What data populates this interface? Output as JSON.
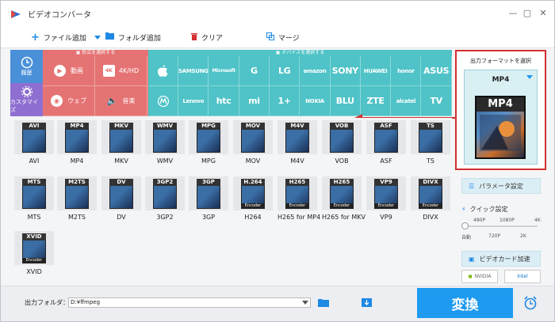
{
  "window": {
    "title": "ビデオコンバータ",
    "controls": [
      "minimize-icon",
      "maximize-icon",
      "close-icon"
    ]
  },
  "toolbar": {
    "add_file": "ファイル追加",
    "add_folder": "フォルダ追加",
    "clear": "クリア",
    "merge": "マージ"
  },
  "left_tabs": {
    "history": "履歴",
    "custom": "カスタマイズ"
  },
  "category_panel": {
    "header": "形式を選択する",
    "items": [
      "動画",
      "4K/HD",
      "ウェブ",
      "音楽"
    ]
  },
  "device_panel": {
    "header": "デバイスを選択する",
    "row1": [
      "",
      "SAMSUNG",
      "Microsoft",
      "G",
      "LG",
      "amazon",
      "SONY",
      "HUAWEI",
      "honor",
      "ASUS"
    ],
    "row2": [
      "",
      "Lenovo",
      "htc",
      "mi",
      "1+",
      "NOKIA",
      "BLU",
      "ZTE",
      "alcatel",
      "TV"
    ]
  },
  "formats": [
    {
      "tag": "AVI",
      "label": "AVI"
    },
    {
      "tag": "MP4",
      "label": "MP4"
    },
    {
      "tag": "MKV",
      "label": "MKV"
    },
    {
      "tag": "WMV",
      "label": "WMV"
    },
    {
      "tag": "MPG",
      "label": "MPG"
    },
    {
      "tag": "MOV",
      "label": "MOV"
    },
    {
      "tag": "M4V",
      "label": "M4V"
    },
    {
      "tag": "VOB",
      "label": "VOB"
    },
    {
      "tag": "ASF",
      "label": "ASF"
    },
    {
      "tag": "TS",
      "label": "TS"
    },
    {
      "tag": "MTS",
      "label": "MTS"
    },
    {
      "tag": "M2TS",
      "label": "M2TS"
    },
    {
      "tag": "DV",
      "label": "DV"
    },
    {
      "tag": "3GP2",
      "label": "3GP2"
    },
    {
      "tag": "3GP",
      "label": "3GP"
    },
    {
      "tag": "H.264",
      "label": "H264",
      "enc": "Encoder"
    },
    {
      "tag": "H265",
      "label": "H265 for MP4",
      "enc": "Encoder"
    },
    {
      "tag": "H265",
      "label": "H265 for MKV",
      "enc": "Encoder"
    },
    {
      "tag": "VP9",
      "label": "VP9",
      "enc": "Encoder"
    },
    {
      "tag": "DIVX",
      "label": "DIVX",
      "enc": "Encoder"
    },
    {
      "tag": "XVID",
      "label": "XVID",
      "enc": "Encoder"
    }
  ],
  "output_format": {
    "title": "出力フォーマットを選択",
    "selected": "MP4",
    "big_tag": "MP4"
  },
  "settings": {
    "param": "パラメータ設定",
    "quick": "クイック設定",
    "slider_top": [
      "480P",
      "1080P",
      "4K"
    ],
    "slider_bottom": [
      "自動",
      "720P",
      "2K"
    ],
    "gpu": "ビデオカード加速",
    "nvidia": "NVIDIA",
    "intel": "Intel"
  },
  "bottom": {
    "output_label": "出力フォルダ：",
    "output_path": "D:¥ffmpeg",
    "convert": "変換"
  },
  "colors": {
    "category_red": "#e57373",
    "device_teal": "#4fc3c7",
    "accent_blue": "#1e9af0",
    "highlight_red": "#d32f2f"
  }
}
